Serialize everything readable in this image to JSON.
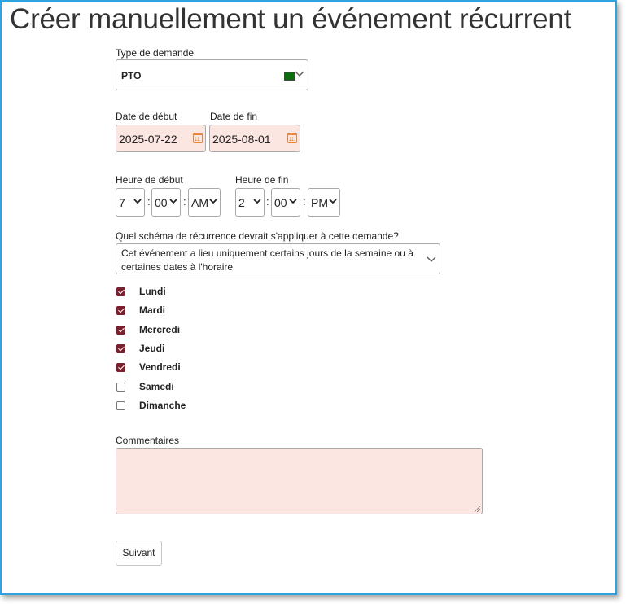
{
  "page": {
    "title": "Créer manuellement un événement récurrent"
  },
  "request_type": {
    "label": "Type de demande",
    "value": "PTO",
    "swatch_color": "#0f6b0f"
  },
  "dates": {
    "start_label": "Date de début",
    "start_value": "2025-07-22",
    "end_label": "Date de fin",
    "end_value": "2025-08-01"
  },
  "times": {
    "start_label": "Heure de début",
    "start_hour": "7",
    "start_minute": "00",
    "start_ampm": "AM",
    "end_label": "Heure de fin",
    "end_hour": "2",
    "end_minute": "00",
    "end_ampm": "PM",
    "separator": ":"
  },
  "recurrence": {
    "label": "Quel schéma de récurrence devrait s'appliquer à cette demande?",
    "value": "Cet événement a lieu uniquement certains jours de la semaine ou à certaines dates à l'horaire"
  },
  "days": [
    {
      "label": "Lundi",
      "checked": true
    },
    {
      "label": "Mardi",
      "checked": true
    },
    {
      "label": "Mercredi",
      "checked": true
    },
    {
      "label": "Jeudi",
      "checked": true
    },
    {
      "label": "Vendredi",
      "checked": true
    },
    {
      "label": "Samedi",
      "checked": false
    },
    {
      "label": "Dimanche",
      "checked": false
    }
  ],
  "comments": {
    "label": "Commentaires",
    "value": ""
  },
  "actions": {
    "next_label": "Suivant"
  },
  "colors": {
    "frame_border": "#2ea3e0",
    "field_pink": "#fce6e2",
    "checkbox_checked": "#7b1f2f",
    "calendar_icon": "#e8873a"
  },
  "icons": {
    "calendar": "calendar-icon",
    "dropdown": "chevron-down-icon"
  }
}
